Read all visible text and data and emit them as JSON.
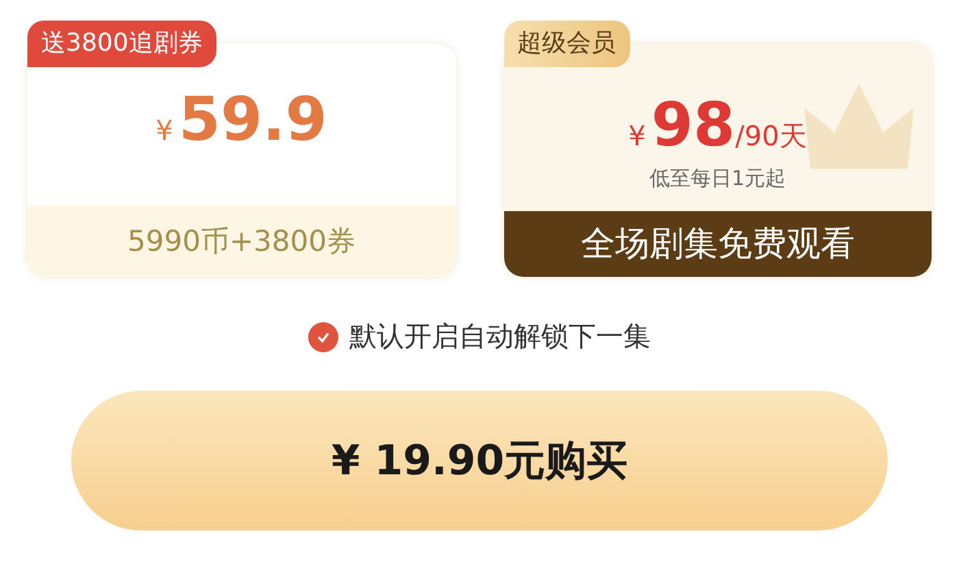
{
  "plans": [
    {
      "kind": "coins",
      "badge": "送3800追剧券",
      "currency": "¥",
      "price": "59.9",
      "detail": "5990币+3800券"
    },
    {
      "kind": "vip",
      "badge": "超级会员",
      "currency": "¥",
      "price": "98",
      "period": "/90天",
      "note": "低至每日1元起",
      "banner": "全场剧集免费观看"
    }
  ],
  "auto_unlock": {
    "checked": true,
    "label": "默认开启自动解锁下一集"
  },
  "buy_button": "¥ 19.90元购买"
}
